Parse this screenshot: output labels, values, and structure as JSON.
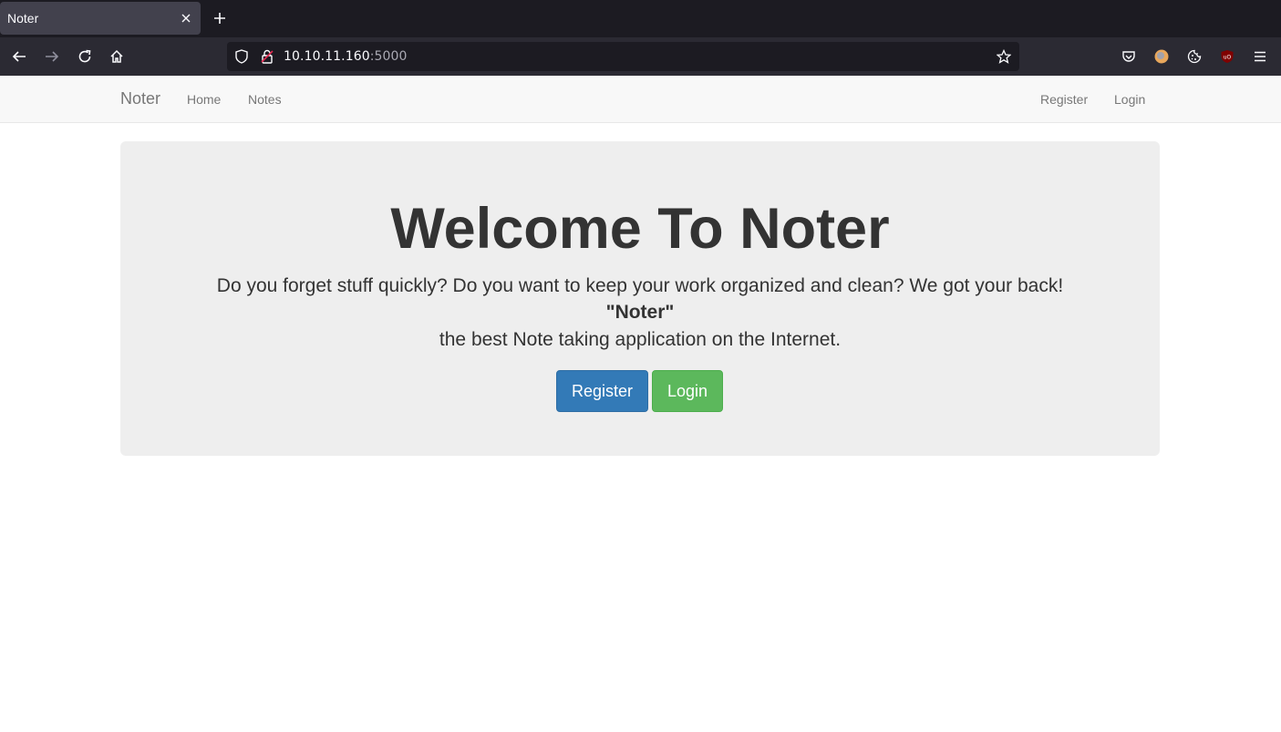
{
  "browser": {
    "tab_title": "Noter",
    "url_host": "10.10.11.160",
    "url_port": ":5000"
  },
  "site": {
    "brand": "Noter",
    "nav_left": [
      "Home",
      "Notes"
    ],
    "nav_right": [
      "Register",
      "Login"
    ]
  },
  "hero": {
    "title": "Welcome To Noter",
    "lead": "Do you forget stuff quickly? Do you want to keep your work organized and clean? We got your back!",
    "tagline_name": "\"Noter\"",
    "tagline_rest": "the best Note taking application on the Internet.",
    "register_label": "Register",
    "login_label": "Login"
  },
  "colors": {
    "primary": "#337ab7",
    "success": "#5cb85c"
  }
}
